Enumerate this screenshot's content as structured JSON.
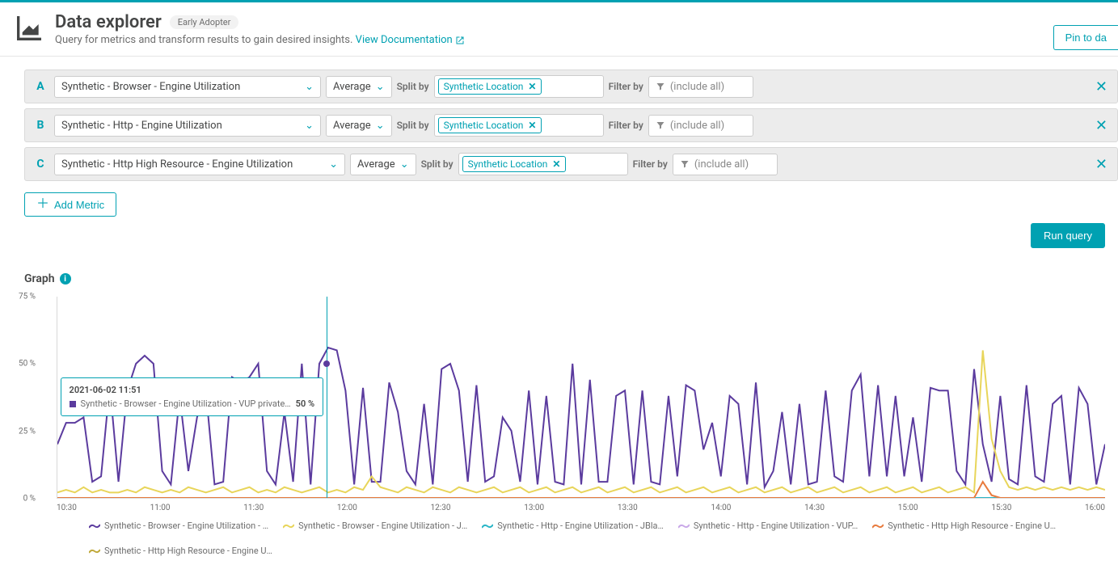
{
  "header": {
    "title": "Data explorer",
    "badge": "Early Adopter",
    "subtitle": "Query for metrics and transform results to gain desired insights. ",
    "doc_link": "View Documentation",
    "pin_button": "Pin to da"
  },
  "metrics": {
    "rows": [
      {
        "letter": "A",
        "name": "Synthetic - Browser - Engine Utilization",
        "agg": "Average",
        "split_label": "Split by",
        "split_chip": "Synthetic Location",
        "filter_label": "Filter by",
        "filter_placeholder": "(include all)"
      },
      {
        "letter": "B",
        "name": "Synthetic - Http - Engine Utilization",
        "agg": "Average",
        "split_label": "Split by",
        "split_chip": "Synthetic Location",
        "filter_label": "Filter by",
        "filter_placeholder": "(include all)"
      },
      {
        "letter": "C",
        "name": "Synthetic - Http High Resource - Engine Utilization",
        "agg": "Average",
        "split_label": "Split by",
        "split_chip": "Synthetic Location",
        "filter_label": "Filter by",
        "filter_placeholder": "(include all)"
      }
    ],
    "add_label": "Add Metric",
    "run_label": "Run query"
  },
  "graph": {
    "title": "Graph",
    "tooltip_time": "2021-06-02 11:51",
    "tooltip_series": "Synthetic - Browser - Engine Utilization - VUP private…",
    "tooltip_value": "50 %",
    "legend": [
      {
        "color": "#5b3b9e",
        "label": "Synthetic - Browser - Engine Utilization - …"
      },
      {
        "color": "#e8d55a",
        "label": "Synthetic - Browser - Engine Utilization - J…"
      },
      {
        "color": "#2ab6c7",
        "label": "Synthetic - Http - Engine Utilization - JBla…"
      },
      {
        "color": "#c9a8e8",
        "label": "Synthetic - Http - Engine Utilization - VUP…"
      },
      {
        "color": "#e87b3e",
        "label": "Synthetic - Http High Resource - Engine U…"
      },
      {
        "color": "#c0a93a",
        "label": "Synthetic - Http High Resource - Engine U…"
      }
    ]
  },
  "chart_data": {
    "type": "line",
    "ylabel": "%",
    "ylim": [
      0,
      75
    ],
    "y_ticks": [
      "75 %",
      "50 %",
      "25 %",
      "0 %"
    ],
    "x_ticks": [
      "10:30",
      "11:00",
      "11:30",
      "12:00",
      "12:30",
      "13:00",
      "13:30",
      "14:00",
      "14:30",
      "15:00",
      "15:30",
      "16:00"
    ],
    "hover_x": "11:51",
    "hover_vline_pct": 25.7,
    "series": [
      {
        "name": "Synthetic - Browser - Engine Utilization - VUP private",
        "color": "#5b3b9e",
        "values": [
          20,
          28,
          28,
          30,
          6,
          8,
          42,
          6,
          40,
          50,
          53,
          50,
          10,
          5,
          38,
          10,
          30,
          40,
          5,
          6,
          45,
          43,
          45,
          50,
          10,
          5,
          32,
          6,
          50,
          5,
          50,
          56,
          55,
          40,
          5,
          41,
          6,
          6,
          43,
          32,
          10,
          5,
          35,
          5,
          48,
          50,
          40,
          6,
          42,
          6,
          8,
          30,
          25,
          6,
          40,
          5,
          38,
          6,
          5,
          50,
          5,
          44,
          6,
          6,
          38,
          40,
          5,
          40,
          6,
          5,
          38,
          8,
          42,
          40,
          18,
          28,
          8,
          38,
          35,
          5,
          43,
          4,
          10,
          32,
          5,
          35,
          5,
          6,
          40,
          8,
          6,
          40,
          46,
          8,
          42,
          8,
          38,
          8,
          30,
          6,
          41,
          40,
          40,
          10,
          5,
          48,
          20,
          6,
          38,
          7,
          5,
          42,
          8,
          6,
          35,
          38,
          5,
          41,
          35,
          5,
          20
        ]
      },
      {
        "name": "Synthetic - Browser - Engine Utilization - J",
        "color": "#e8d55a",
        "values": [
          2,
          3,
          2,
          4,
          2,
          3,
          2,
          2,
          3,
          2,
          4,
          3,
          2,
          3,
          2,
          4,
          3,
          2,
          3,
          4,
          2,
          3,
          4,
          2,
          3,
          2,
          4,
          3,
          2,
          3,
          4,
          2,
          3,
          2,
          4,
          3,
          8,
          4,
          3,
          2,
          4,
          3,
          2,
          4,
          3,
          2,
          4,
          3,
          2,
          3,
          4,
          2,
          3,
          4,
          2,
          3,
          4,
          2,
          3,
          4,
          2,
          3,
          4,
          2,
          3,
          4,
          2,
          3,
          4,
          2,
          3,
          4,
          2,
          3,
          4,
          2,
          3,
          4,
          2,
          3,
          4,
          2,
          3,
          4,
          2,
          3,
          4,
          2,
          3,
          4,
          2,
          3,
          4,
          2,
          3,
          4,
          2,
          3,
          4,
          2,
          3,
          4,
          2,
          3,
          4,
          2,
          55,
          22,
          10,
          4,
          3,
          4,
          3,
          4,
          3,
          4,
          3,
          4,
          3,
          4,
          3
        ]
      },
      {
        "name": "Synthetic - Http - Engine Utilization - JBla",
        "color": "#2ab6c7",
        "values": [
          0,
          0,
          0,
          0,
          0,
          0,
          0,
          0,
          0,
          0,
          0,
          0,
          0,
          0,
          0,
          0,
          0,
          0,
          0,
          0,
          0,
          0,
          0,
          0,
          0,
          0,
          0,
          0,
          0,
          0,
          0,
          0,
          0,
          0,
          0,
          0,
          0,
          0,
          0,
          0,
          0,
          0,
          0,
          0,
          0,
          0,
          0,
          0,
          0,
          0,
          0,
          0,
          0,
          0,
          0,
          0,
          0,
          0,
          0,
          0,
          0,
          0,
          0,
          0,
          0,
          0,
          0,
          0,
          0,
          0,
          0,
          0,
          0,
          0,
          0,
          0,
          0,
          0,
          0,
          0,
          0,
          0,
          0,
          0,
          0,
          0,
          0,
          0,
          0,
          0,
          0,
          0,
          0,
          0,
          0,
          0,
          0,
          0,
          0,
          0,
          0,
          0,
          0,
          0,
          0,
          0,
          0,
          0,
          0,
          0,
          0,
          0,
          0,
          0,
          0,
          0,
          0,
          0,
          0,
          0,
          0
        ]
      },
      {
        "name": "Synthetic - Http High Resource - Engine U",
        "color": "#e87b3e",
        "values": [
          0,
          0,
          0,
          0,
          0,
          0,
          0,
          0,
          0,
          0,
          0,
          0,
          0,
          0,
          0,
          0,
          0,
          0,
          0,
          0,
          0,
          0,
          0,
          0,
          0,
          0,
          0,
          0,
          0,
          0,
          0,
          0,
          0,
          0,
          0,
          0,
          0,
          0,
          0,
          0,
          0,
          0,
          0,
          0,
          0,
          0,
          0,
          0,
          0,
          0,
          0,
          0,
          0,
          0,
          0,
          0,
          0,
          0,
          0,
          0,
          0,
          0,
          0,
          0,
          0,
          0,
          0,
          0,
          0,
          0,
          0,
          0,
          0,
          0,
          0,
          0,
          0,
          0,
          0,
          0,
          0,
          0,
          0,
          0,
          0,
          0,
          0,
          0,
          0,
          0,
          0,
          0,
          0,
          0,
          0,
          0,
          0,
          0,
          0,
          0,
          0,
          0,
          0,
          0,
          0,
          0,
          6,
          1,
          0,
          0,
          0,
          0,
          0,
          0,
          0,
          0,
          0,
          0,
          0,
          0,
          0
        ]
      }
    ]
  }
}
